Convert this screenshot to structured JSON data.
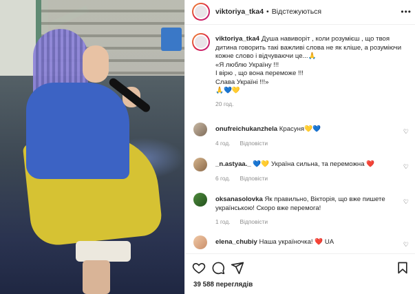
{
  "post": {
    "username": "viktoriya_tka4",
    "follow_label": "Відстежуються",
    "caption_lines": [
      "Душа навиворіт , коли розумієш , що твоя дитина говорить такі важливі слова не як кліше, а розуміючи кожне слово і відчуваючи це...🙏",
      "«Я люблю Україну !!!",
      "І вірю , що вона переможе !!!",
      "Слава Україні !!!»",
      "🙏💙💛"
    ],
    "caption_time": "20 год.",
    "views": "39 588 переглядів"
  },
  "comments": [
    {
      "username": "onufreichukanzhela",
      "text": "Красуня💛💙",
      "time": "4 год.",
      "reply": "Відповісти"
    },
    {
      "username": "_n.astyaa._",
      "text": "💙💛 Україна сильна, та переможна ❤️",
      "time": "6 год.",
      "reply": "Відповісти"
    },
    {
      "username": "oksanasolovka",
      "text": "Як правильно, Вікторія, що вже пишете українською! Скоро вже перемога!",
      "time": "1 год.",
      "reply": "Відповісти"
    },
    {
      "username": "elena_chubiy",
      "text": "Наша україночка! ❤️ UA",
      "time": "",
      "reply": ""
    }
  ],
  "icons": {
    "more": "ellipsis-icon",
    "like": "heart-icon",
    "comment": "comment-icon",
    "share": "paper-plane-icon",
    "save": "bookmark-icon"
  }
}
